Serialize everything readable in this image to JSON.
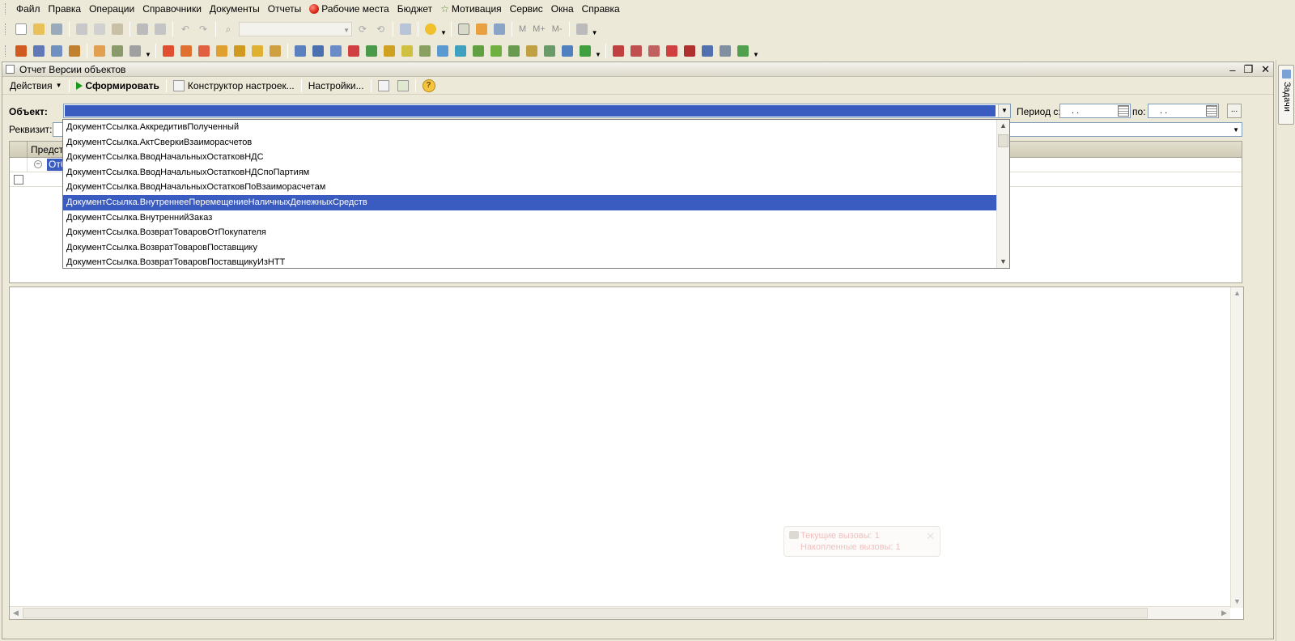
{
  "menu": [
    "Файл",
    "Правка",
    "Операции",
    "Справочники",
    "Документы",
    "Отчеты",
    "Рабочие места",
    "Бюджет",
    "Мотивация",
    "Сервис",
    "Окна",
    "Справка"
  ],
  "toolbar1": {
    "m": "M",
    "m_plus": "M+",
    "m_minus": "M-"
  },
  "task_panel": {
    "label": "Задачи"
  },
  "window": {
    "title": "Отчет  Версии объектов",
    "minimize": "–",
    "restore": "❐",
    "close": "✕"
  },
  "actions": {
    "actions_label": "Действия",
    "generate": "Сформировать",
    "constructor": "Конструктор настроек...",
    "settings": "Настройки..."
  },
  "filters": {
    "object_label": "Объект:",
    "requisite_label": "Реквизит:",
    "period_from_label": "Период с:",
    "period_to_label": "по:",
    "date_from": ". .",
    "date_to": ". .",
    "more_button": "..."
  },
  "grid": {
    "column_header": "Предста",
    "row_value": "Отб"
  },
  "dropdown": {
    "items": [
      "ДокументСсылка.АккредитивПолученный",
      "ДокументСсылка.АктСверкиВзаиморасчетов",
      "ДокументСсылка.ВводНачальныхОстатковНДС",
      "ДокументСсылка.ВводНачальныхОстатковНДСпоПартиям",
      "ДокументСсылка.ВводНачальныхОстатковПоВзаиморасчетам",
      "ДокументСсылка.ВнутреннееПеремещениеНаличныхДенежныхСредств",
      "ДокументСсылка.ВнутреннийЗаказ",
      "ДокументСсылка.ВозвратТоваровОтПокупателя",
      "ДокументСсылка.ВозвратТоваровПоставщику",
      "ДокументСсылка.ВозвратТоваровПоставщикуИзНТТ"
    ],
    "selected_index": 5
  },
  "notification": {
    "line1": "Текущие вызовы: 1",
    "line2": "Накопленные вызовы: 1"
  },
  "colors": {
    "selection": "#3a5bbf",
    "window_bg": "#ece9d8"
  }
}
